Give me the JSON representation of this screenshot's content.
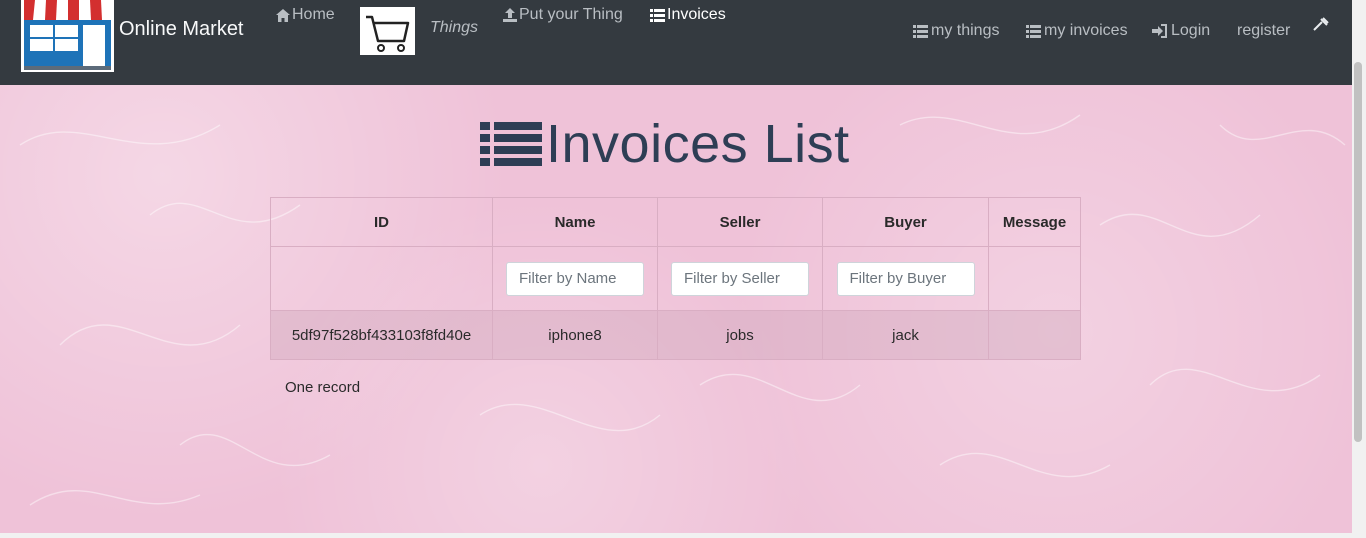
{
  "brand": {
    "name": "Online Market"
  },
  "nav": {
    "home": "Home",
    "things": "Things",
    "put_thing": "Put your Thing",
    "invoices": "Invoices",
    "my_things": "my things",
    "my_invoices": "my invoices",
    "login": "Login",
    "register": "register"
  },
  "page": {
    "title": "Invoices List"
  },
  "table": {
    "headers": [
      "ID",
      "Name",
      "Seller",
      "Buyer",
      "Message"
    ],
    "filters": {
      "name_placeholder": "Filter by Name",
      "seller_placeholder": "Filter by Seller",
      "buyer_placeholder": "Filter by Buyer"
    },
    "rows": [
      {
        "id": "5df97f528bf433103f8fd40e",
        "name": "iphone8",
        "seller": "jobs",
        "buyer": "jack",
        "message": ""
      }
    ]
  },
  "record_count": "One record",
  "colors": {
    "navbar": "#343a40",
    "background": "#efc2d8",
    "title": "#2e3e55"
  },
  "icons": [
    "shop-logo-icon",
    "home-icon",
    "cart-icon",
    "upload-icon",
    "list-icon",
    "login-icon",
    "tool-icon"
  ]
}
